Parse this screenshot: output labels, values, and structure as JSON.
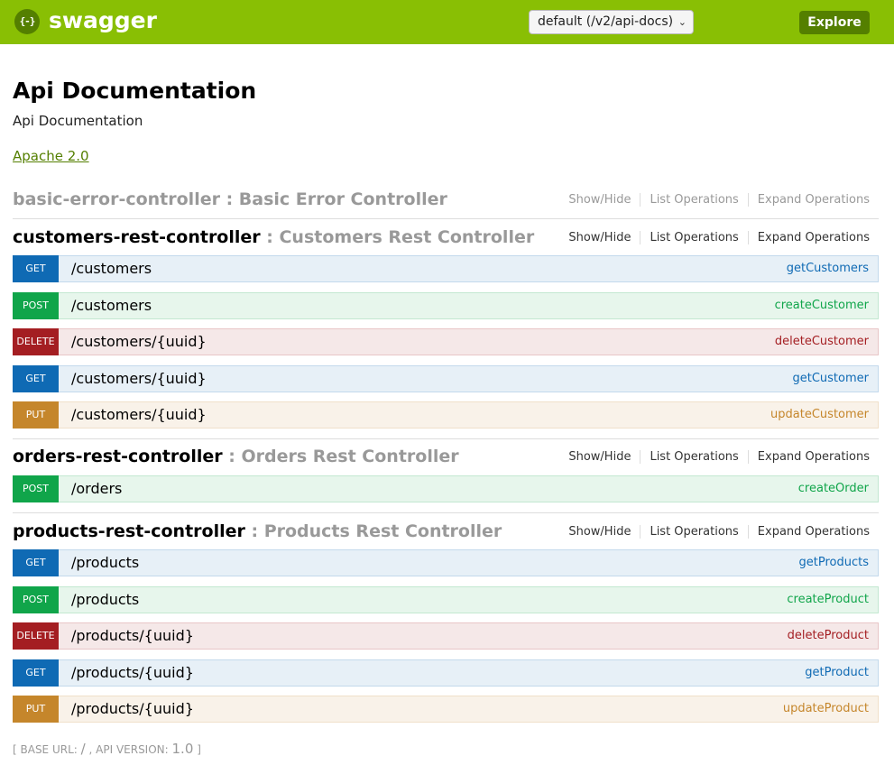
{
  "header": {
    "logo_glyph": "{-}",
    "logo_text": "swagger",
    "spec_select": "default (/v2/api-docs)",
    "explore_label": "Explore",
    "brand_color": "#89bf04"
  },
  "info": {
    "title": "Api Documentation",
    "description": "Api Documentation",
    "license": "Apache 2.0"
  },
  "resource_options": {
    "show_hide": "Show/Hide",
    "list_operations": "List Operations",
    "expand_operations": "Expand Operations"
  },
  "resources": [
    {
      "name": "basic-error-controller",
      "separator": " : ",
      "description": "Basic Error Controller",
      "operations": []
    },
    {
      "name": "customers-rest-controller",
      "separator": " : ",
      "description": "Customers Rest Controller",
      "operations": [
        {
          "method": "GET",
          "path": "/customers",
          "nickname": "getCustomers"
        },
        {
          "method": "POST",
          "path": "/customers",
          "nickname": "createCustomer"
        },
        {
          "method": "DELETE",
          "path": "/customers/{uuid}",
          "nickname": "deleteCustomer"
        },
        {
          "method": "GET",
          "path": "/customers/{uuid}",
          "nickname": "getCustomer"
        },
        {
          "method": "PUT",
          "path": "/customers/{uuid}",
          "nickname": "updateCustomer"
        }
      ]
    },
    {
      "name": "orders-rest-controller",
      "separator": " : ",
      "description": "Orders Rest Controller",
      "operations": [
        {
          "method": "POST",
          "path": "/orders",
          "nickname": "createOrder"
        }
      ]
    },
    {
      "name": "products-rest-controller",
      "separator": " : ",
      "description": "Products Rest Controller",
      "operations": [
        {
          "method": "GET",
          "path": "/products",
          "nickname": "getProducts"
        },
        {
          "method": "POST",
          "path": "/products",
          "nickname": "createProduct"
        },
        {
          "method": "DELETE",
          "path": "/products/{uuid}",
          "nickname": "deleteProduct"
        },
        {
          "method": "GET",
          "path": "/products/{uuid}",
          "nickname": "getProduct"
        },
        {
          "method": "PUT",
          "path": "/products/{uuid}",
          "nickname": "updateProduct"
        }
      ]
    }
  ],
  "footer": {
    "open": "[ ",
    "base_url_label": "BASE URL: ",
    "base_url": "/",
    "sep": " , ",
    "api_version_label": "API VERSION: ",
    "api_version": "1.0",
    "close": " ]"
  }
}
